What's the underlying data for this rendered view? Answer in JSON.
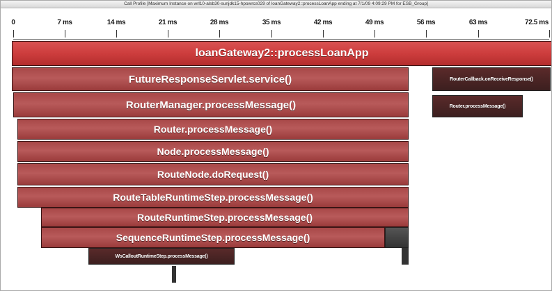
{
  "window": {
    "title": "Call Profile [Maximum Instance on wrl10-alsb30-sunjdk15-hpowrcs029 of loanGateway2::processLoanApp ending at 7/1/09 4:09:29 PM for ESB_Group]"
  },
  "axis": {
    "unit": "ms",
    "tick_labels": [
      "0",
      "7 ms",
      "14 ms",
      "21 ms",
      "28 ms",
      "35 ms",
      "42 ms",
      "49 ms",
      "56 ms",
      "63 ms",
      "72.5 ms"
    ]
  },
  "frames": {
    "root": "loanGateway2::processLoanApp",
    "future_response_servlet": "FutureResponseServlet.service()",
    "router_callback": "RouterCallback.onReceiveResponse()",
    "router_manager": "RouterManager.processMessage()",
    "router_process_small": "Router.processMessage()",
    "router_process": "Router.processMessage()",
    "node_process": "Node.processMessage()",
    "route_node": "RouteNode.doRequest()",
    "route_table_step": "RouteTableRuntimeStep.processMessage()",
    "route_runtime_step": "RouteRuntimeStep.processMessage()",
    "sequence_runtime_step": "SequenceRuntimeStep.processMessage()",
    "ws_callout_step": "WsCalloutRuntimeStep.processMessage()"
  },
  "colors": {
    "frame_red": "#a84848",
    "root_red": "#cd3d3d",
    "frame_dark": "#3c1f1f"
  }
}
